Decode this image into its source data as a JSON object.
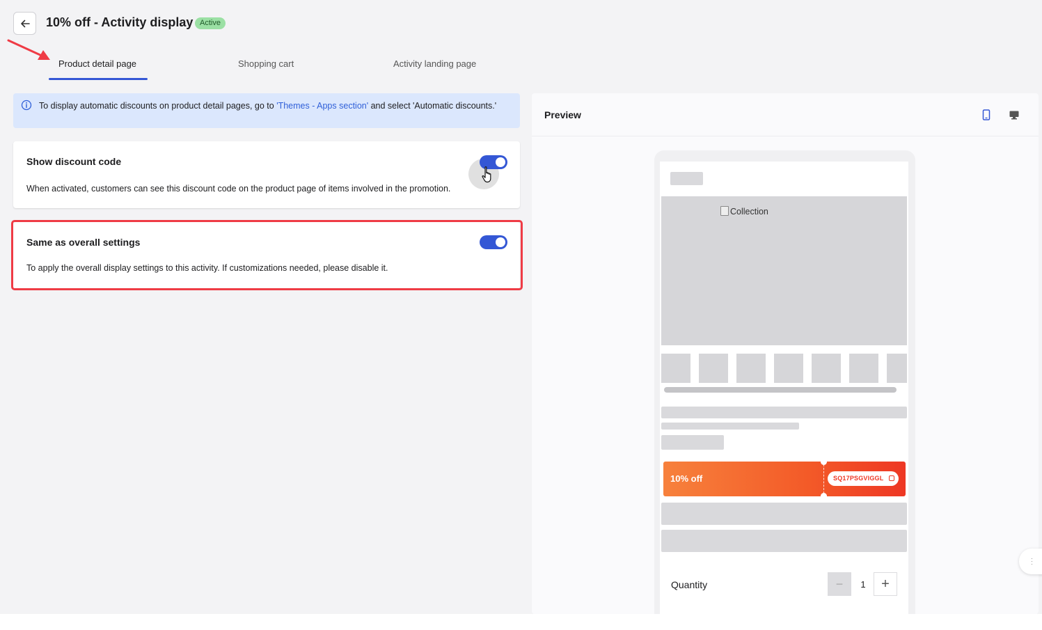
{
  "header": {
    "title": "10% off - Activity display",
    "status": "Active"
  },
  "tabs": [
    {
      "label": "Product detail page",
      "active": true
    },
    {
      "label": "Shopping cart",
      "active": false
    },
    {
      "label": "Activity landing page",
      "active": false
    }
  ],
  "info_banner": {
    "text_before": "To display automatic discounts on product detail pages, go to ",
    "link": "'Themes - Apps section'",
    "text_after": " and select 'Automatic discounts.'"
  },
  "settings": {
    "show_discount_code": {
      "title": "Show discount code",
      "description": "When activated, customers can see this discount code on the product page of items involved in the promotion.",
      "enabled": true
    },
    "same_as_overall": {
      "title": "Same as overall settings",
      "description": "To apply the overall display settings to this activity. If customizations needed, please disable it.",
      "enabled": true
    }
  },
  "preview": {
    "title": "Preview",
    "image_alt": "Collection",
    "coupon": {
      "label": "10% off",
      "code": "SQ17PSGVIGGL"
    },
    "quantity": {
      "label": "Quantity",
      "minus": "−",
      "value": "1",
      "plus": "+"
    }
  },
  "colors": {
    "accent": "#3457d5",
    "badge_bg": "#9be0a4",
    "banner_bg": "#dbe7fd",
    "highlight": "#ef3b45",
    "coupon_start": "#f7813c",
    "coupon_end": "#ee3724"
  }
}
